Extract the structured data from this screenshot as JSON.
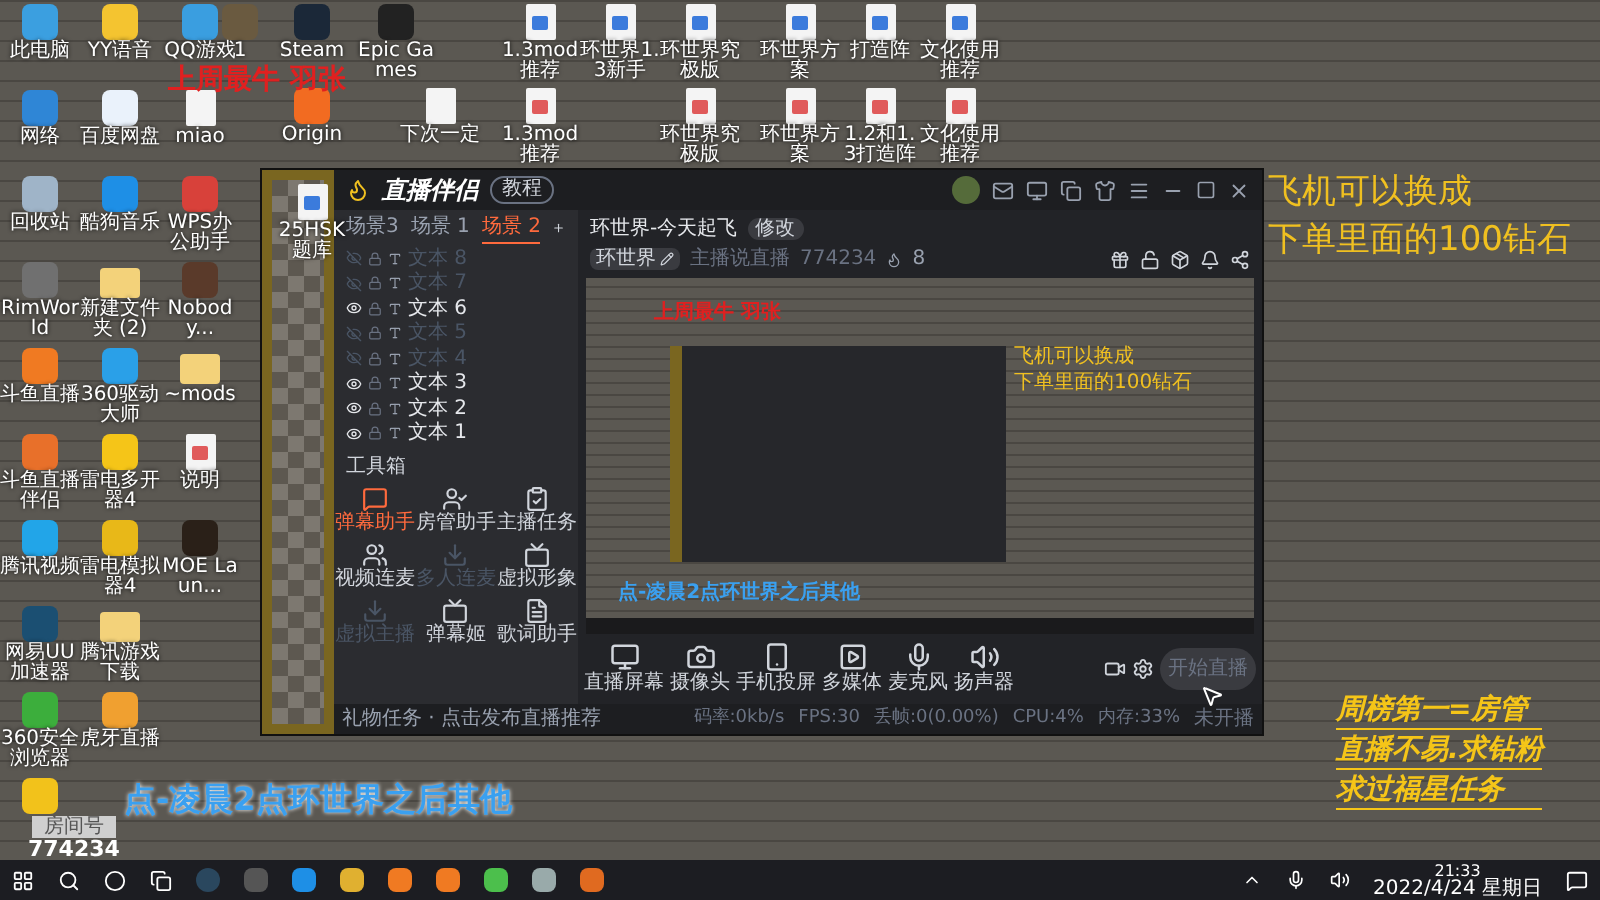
{
  "desktop": {
    "icon_columns": [
      [
        {
          "label": "此电脑",
          "kind": "app",
          "color": "#3b9fe0"
        },
        {
          "label": "网络",
          "kind": "app",
          "color": "#2f86d6"
        },
        {
          "label": "回收站",
          "kind": "app",
          "color": "#9fb4c8"
        },
        {
          "label": "RimWorld",
          "kind": "app",
          "color": "#707070"
        },
        {
          "label": "斗鱼直播",
          "kind": "app",
          "color": "#f07a22"
        },
        {
          "label": "斗鱼直播伴侣",
          "kind": "app",
          "color": "#e8702a"
        },
        {
          "label": "腾讯视频",
          "kind": "app",
          "color": "#22a5e8"
        },
        {
          "label": "网易UU加速器",
          "kind": "app",
          "color": "#1b4f72"
        },
        {
          "label": "360安全浏览器",
          "kind": "app",
          "color": "#3cae3c"
        },
        {
          "kind": "app",
          "color": "#f2c21b"
        }
      ],
      [
        {
          "label": "YY语音",
          "kind": "app",
          "color": "#f4c430"
        },
        {
          "label": "百度网盘",
          "kind": "app",
          "color": "#eaf2fb"
        },
        {
          "label": "酷狗音乐",
          "kind": "app",
          "color": "#1e8fe6"
        },
        {
          "label": "新建文件夹 (2)",
          "kind": "folder"
        },
        {
          "label": "360驱动大师",
          "kind": "app",
          "color": "#2aa0e8"
        },
        {
          "label": "雷电多开器4",
          "kind": "app",
          "color": "#f5c518"
        },
        {
          "label": "雷电模拟器4",
          "kind": "app",
          "color": "#e8b818"
        },
        {
          "label": "腾讯游戏下载",
          "kind": "folder"
        },
        {
          "label": "虎牙直播",
          "kind": "app",
          "color": "#f0a030"
        }
      ],
      [
        {
          "label": "QQ游戏",
          "kind": "app",
          "color": "#3a9ee0"
        },
        {
          "label": "miao",
          "kind": "file"
        },
        {
          "label": "WPS办公助手",
          "kind": "app",
          "color": "#d8413a"
        },
        {
          "label": "Nobody...",
          "kind": "app",
          "color": "#5a3a2a"
        },
        {
          "label": "~mods",
          "kind": "folder"
        },
        {
          "label": "说明",
          "kind": "pdf"
        },
        {
          "label": "MOE Laun...",
          "kind": "app",
          "color": "#2a2018"
        }
      ]
    ],
    "scattered_icons": [
      {
        "label": "1",
        "kind": "app",
        "color": "#6a5a40"
      },
      {
        "label": "Steam",
        "kind": "app",
        "color": "#1b2838"
      },
      {
        "label": "Epic Games",
        "kind": "app",
        "color": "#222222"
      },
      {
        "label": "Origin",
        "kind": "app",
        "color": "#f26b21"
      },
      {
        "label": "下次一定",
        "kind": "file"
      },
      {
        "label": "1.3mod推荐",
        "kind": "doc"
      },
      {
        "label": "环世界1.3新手",
        "kind": "doc"
      },
      {
        "label": "环世界究极版",
        "kind": "doc"
      },
      {
        "label": "环世界方案",
        "kind": "doc"
      },
      {
        "label": "打造阵",
        "kind": "doc"
      },
      {
        "label": "文化使用推荐",
        "kind": "doc"
      },
      {
        "label": "1.3mod推荐",
        "kind": "pdf"
      },
      {
        "label": "环世界究极版",
        "kind": "pdf"
      },
      {
        "label": "环世界方案",
        "kind": "pdf"
      },
      {
        "label": "1.2和1.3打造阵",
        "kind": "pdf"
      },
      {
        "label": "文化使用推荐",
        "kind": "pdf"
      },
      {
        "label": "25HSK题库",
        "kind": "doc"
      }
    ]
  },
  "overlays": {
    "top_caption": "上周最牛 羽张",
    "right_caption": [
      "飞机可以换成",
      "下单里面的100钻石"
    ],
    "bottom_right_caption": [
      "周榜第一=房管",
      "直播不易.求钻粉",
      "求过福星任务"
    ],
    "scroll_caption": "点-凌晨2点环世界之后其他",
    "room_label": "房间号",
    "room_number": "774234"
  },
  "app": {
    "title": "直播伴侣",
    "tutorial": "教程",
    "scene_tabs": [
      {
        "label": "场景3",
        "selected": false
      },
      {
        "label": "场景 1",
        "selected": false
      },
      {
        "label": "场景 2",
        "selected": true
      }
    ],
    "layers": [
      {
        "label": "文本 8",
        "visible": false
      },
      {
        "label": "文本 7",
        "visible": false
      },
      {
        "label": "文本 6",
        "visible": true
      },
      {
        "label": "文本 5",
        "visible": false
      },
      {
        "label": "文本 4",
        "visible": false
      },
      {
        "label": "文本 3",
        "visible": true
      },
      {
        "label": "文本 2",
        "visible": true
      },
      {
        "label": "文本 1",
        "visible": true
      }
    ],
    "toolbox_title": "工具箱",
    "tools": [
      {
        "label": "弹幕助手",
        "selected": true,
        "disabled": false
      },
      {
        "label": "房管助手",
        "selected": false,
        "disabled": false
      },
      {
        "label": "主播任务",
        "selected": false,
        "disabled": false
      },
      {
        "label": "视频连麦",
        "selected": false,
        "disabled": false
      },
      {
        "label": "多人连麦",
        "selected": false,
        "disabled": true
      },
      {
        "label": "虚拟形象",
        "selected": false,
        "disabled": false
      },
      {
        "label": "虚拟主播",
        "selected": false,
        "disabled": true
      },
      {
        "label": "弹幕姬",
        "selected": false,
        "disabled": false
      },
      {
        "label": "歌词助手",
        "selected": false,
        "disabled": false
      }
    ],
    "room_title": "环世界-今天起飞",
    "edit_button": "修改",
    "category": "环世界",
    "room_type": "主播说直播",
    "room_id": "774234",
    "viewers": "8",
    "preview": {
      "caption": "上周最牛 羽张",
      "side_caption": [
        "飞机可以换成",
        "下单里面的100钻石"
      ],
      "scroll_caption": "点-凌晨2点环世界之后其他"
    },
    "sources": [
      {
        "label": "直播屏幕",
        "kind": "screen"
      },
      {
        "label": "摄像头",
        "kind": "camera"
      },
      {
        "label": "手机投屏",
        "kind": "phone"
      },
      {
        "label": "多媒体",
        "kind": "media"
      },
      {
        "label": "麦克风",
        "kind": "mic"
      },
      {
        "label": "扬声器",
        "kind": "speaker"
      }
    ],
    "start_button": "开始直播",
    "notice": "礼物任务 · 点击发布直播推荐",
    "stats": [
      "码率:0kb/s",
      "FPS:30",
      "丢帧:0(0.00%)",
      "CPU:4%",
      "内存:33%",
      "未开播"
    ]
  },
  "taskbar": {
    "time": "21:33",
    "date": "2022/4/24 星期日"
  }
}
